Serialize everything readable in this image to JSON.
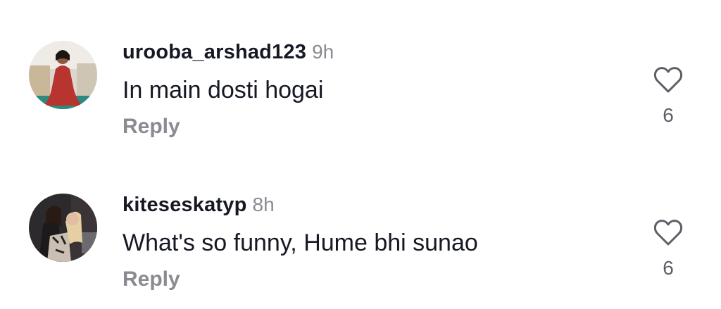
{
  "comments": [
    {
      "username": "urooba_arshad123",
      "time": "9h",
      "text": "In main dosti hogai",
      "reply_label": "Reply",
      "likes": "6",
      "avatar_icon": "user-avatar-photo",
      "like_icon": "heart-outline-icon"
    },
    {
      "username": "kiteseskatyp",
      "time": "8h",
      "text": "What's so funny, Hume bhi sunao",
      "reply_label": "Reply",
      "likes": "6",
      "avatar_icon": "user-avatar-photo",
      "like_icon": "heart-outline-icon"
    }
  ],
  "colors": {
    "username": "#161823",
    "text": "#161823",
    "muted": "#8a8b91",
    "like_icon": "#5e5f66"
  }
}
